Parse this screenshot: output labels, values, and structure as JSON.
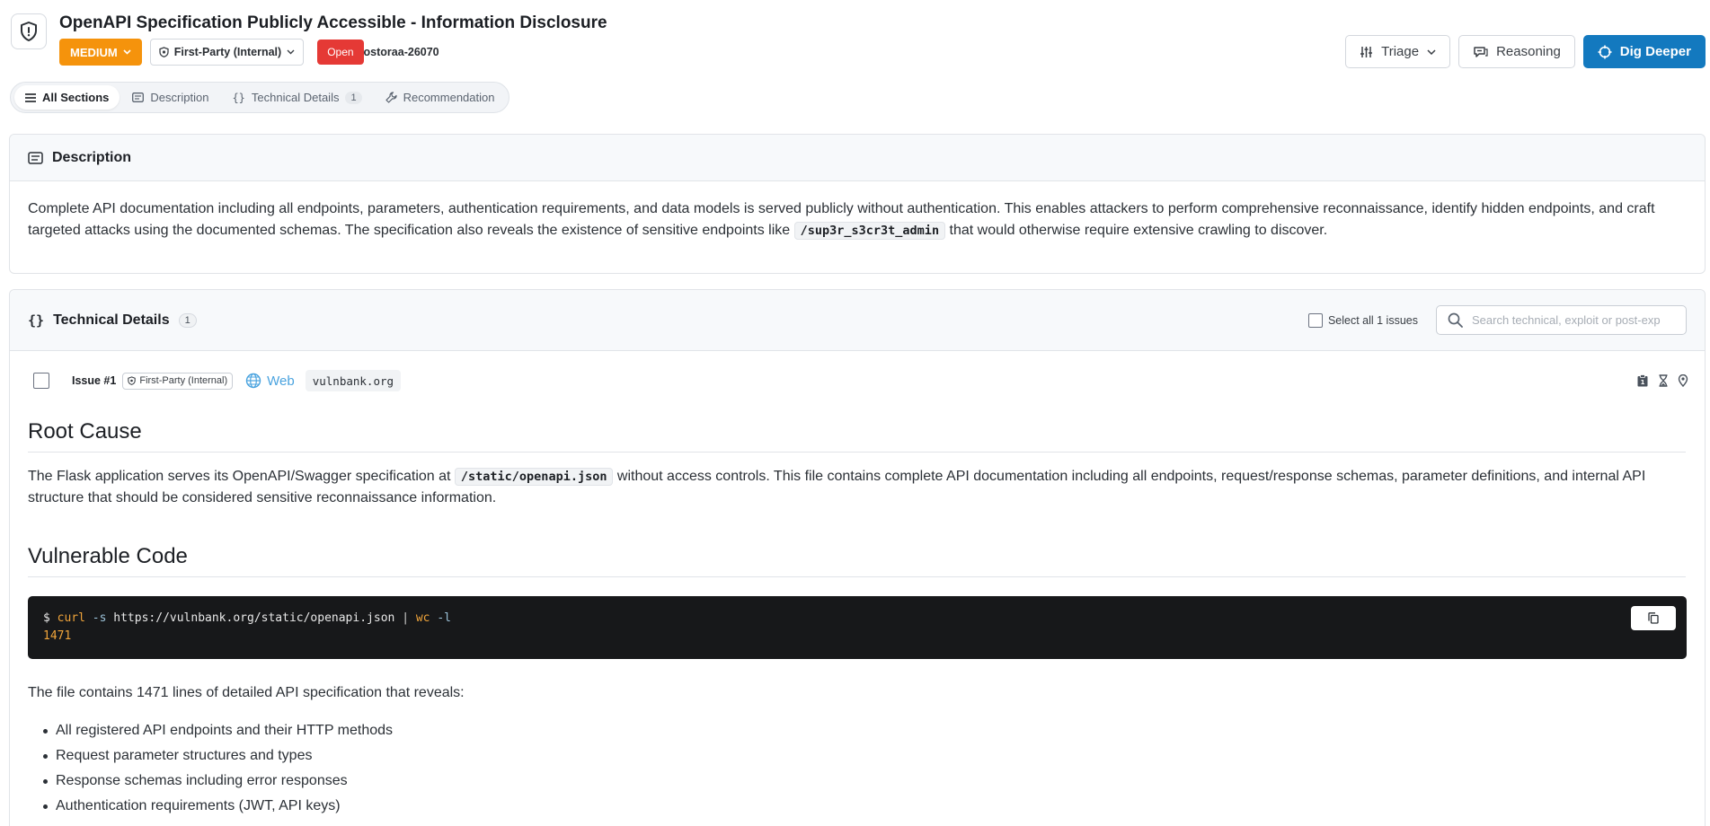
{
  "header": {
    "title": "OpenAPI Specification Publicly Accessible - Information Disclosure",
    "severity": "MEDIUM",
    "party": "First-Party (Internal)",
    "status": "Open",
    "ticket_id": "ostoraa-26070",
    "actions": {
      "triage": "Triage",
      "reasoning": "Reasoning",
      "dig_deeper": "Dig Deeper"
    }
  },
  "tabs": [
    {
      "label": "All Sections",
      "active": true
    },
    {
      "label": "Description"
    },
    {
      "label": "Technical Details",
      "count": "1"
    },
    {
      "label": "Recommendation"
    }
  ],
  "description": {
    "title": "Description",
    "text_before": "Complete API documentation including all endpoints, parameters, authentication requirements, and data models is served publicly without authentication. This enables attackers to perform comprehensive reconnaissance, identify hidden endpoints, and craft targeted attacks using the documented schemas. The specification also reveals the existence of sensitive endpoints like ",
    "code": "/sup3r_s3cr3t_admin",
    "text_after": " that would otherwise require extensive crawling to discover."
  },
  "technical": {
    "title": "Technical Details",
    "count": "1",
    "select_all": "Select all 1 issues",
    "search_placeholder": "Search technical, exploit or post-exp",
    "issue": {
      "label": "Issue #1",
      "party": "First-Party (Internal)",
      "type": "Web",
      "domain": "vulnbank.org"
    },
    "root_cause": {
      "heading": "Root Cause",
      "text_before": "The Flask application serves its OpenAPI/Swagger specification at ",
      "code": "/static/openapi.json",
      "text_after": " without access controls. This file contains complete API documentation including all endpoints, request/response schemas, parameter definitions, and internal API structure that should be considered sensitive reconnaissance information."
    },
    "vulnerable_code": {
      "heading": "Vulnerable Code",
      "prompt": "$",
      "cmd": "curl",
      "flag": "-s",
      "url": "https://vulnbank.org/static/openapi.json",
      "pipe": "|",
      "wc": "wc",
      "wc_flag": "-l",
      "output": "1471"
    },
    "summary": "The file contains 1471 lines of detailed API specification that reveals:",
    "bullets": [
      "All registered API endpoints and their HTTP methods",
      "Request parameter structures and types",
      "Response schemas including error responses",
      "Authentication requirements (JWT, API keys)"
    ]
  },
  "colors": {
    "severity": "#f5930c",
    "open": "#e53935",
    "primary": "#1379bf",
    "link": "#4aa3df"
  },
  "icons": [
    "shield-icon",
    "chevron-down-icon",
    "sliders-icon",
    "brain-icon",
    "crosshair-icon",
    "list-icon",
    "description-icon",
    "braces-icon",
    "wrench-icon",
    "search-icon",
    "globe-icon",
    "clipboard-icon",
    "hourglass-icon",
    "pin-icon",
    "copy-icon"
  ]
}
